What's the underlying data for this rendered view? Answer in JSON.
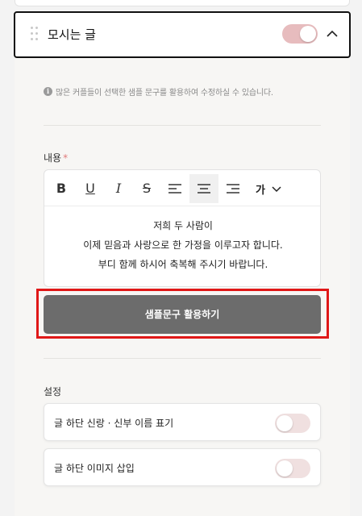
{
  "section": {
    "title": "모시는 글",
    "enabled": true,
    "toggle_color": "#e7bcbe"
  },
  "info": {
    "icon": "info-icon",
    "text": "많은 커플들이 선택한 샘플 문구를 활용하여 수정하실 수 있습니다."
  },
  "content": {
    "label": "내용",
    "required_mark": "*",
    "toolbar": {
      "bold": "B",
      "underline": "U",
      "italic": "I",
      "strike": "S",
      "font_label": "가"
    },
    "lines": [
      "저희 두 사람이",
      "이제 믿음과 사랑으로 한 가정을 이루고자 합니다.",
      "부디 함께 하시어 축복해 주시기 바랍니다."
    ]
  },
  "sample_button": {
    "label": "샘플문구 활용하기",
    "color": "#6c6c6c",
    "highlight_color": "#e01818"
  },
  "settings": {
    "label": "설정",
    "rows": [
      {
        "label": "글 하단 신랑 · 신부 이름 표기",
        "enabled": false
      },
      {
        "label": "글 하단 이미지 삽입",
        "enabled": false
      }
    ]
  }
}
